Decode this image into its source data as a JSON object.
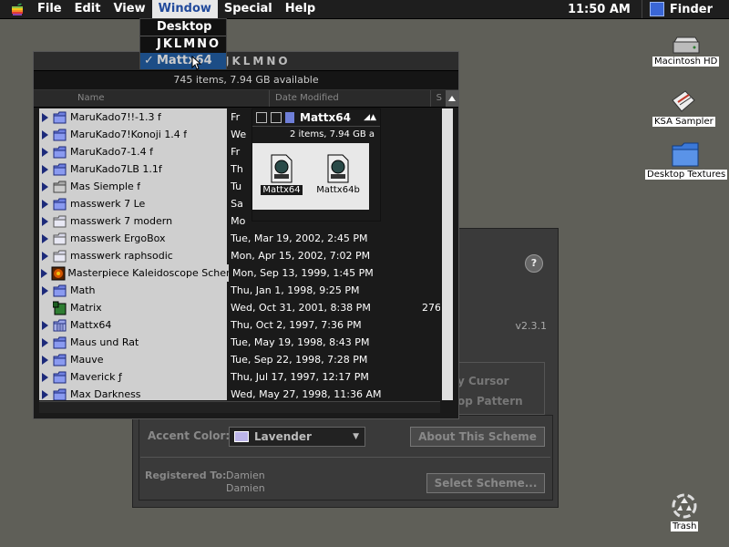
{
  "menubar": {
    "items": [
      "File",
      "Edit",
      "View",
      "Window",
      "Special",
      "Help"
    ],
    "active": "Window",
    "clock": "11:50 AM",
    "app": "Finder"
  },
  "window_menu": {
    "items": [
      {
        "label": "Desktop",
        "checked": false
      },
      {
        "label": "JKLMNO",
        "checked": false
      },
      {
        "label": "Mattx64",
        "checked": true
      }
    ]
  },
  "finder_window": {
    "title": "JKLMNO",
    "info": "745 items, 7.94 GB available",
    "headers": {
      "name": "Name",
      "date": "Date Modified",
      "size": "S"
    },
    "rows": [
      {
        "name": "MaruKado7!!-1.3 f",
        "date": "Fr",
        "size": "",
        "icon": "folder-blue",
        "expand": true
      },
      {
        "name": "MaruKado7!Konoji 1.4 f",
        "date": "We",
        "size": "",
        "icon": "folder-blue",
        "expand": true
      },
      {
        "name": "MaruKado7-1.4 f",
        "date": "Fr",
        "size": "",
        "icon": "folder-blue",
        "expand": true
      },
      {
        "name": "MaruKado7LB 1.1f",
        "date": "Th",
        "size": "",
        "icon": "folder-blue",
        "expand": true
      },
      {
        "name": "Mas Siemple f",
        "date": "Tu",
        "size": "",
        "icon": "folder-gray",
        "expand": true
      },
      {
        "name": "masswerk 7 Le",
        "date": "Sa",
        "size": "",
        "icon": "folder-blue",
        "expand": true
      },
      {
        "name": "masswerk 7 modern",
        "date": "Mo",
        "size": "",
        "icon": "folder-plain",
        "expand": true
      },
      {
        "name": "masswerk ErgoBox",
        "date": "Tue, Mar 19, 2002, 2:45 PM",
        "size": "",
        "icon": "folder-plain",
        "expand": true
      },
      {
        "name": "masswerk raphsodic",
        "date": "Mon, Apr 15, 2002, 7:02 PM",
        "size": "",
        "icon": "folder-plain",
        "expand": true
      },
      {
        "name": "Masterpiece Kaleidoscope Scheme",
        "date": "Mon, Sep 13, 1999, 1:45 PM",
        "size": "",
        "icon": "kaleidoscope",
        "expand": true
      },
      {
        "name": "Math",
        "date": "Thu, Jan 1, 1998, 9:25 PM",
        "size": "",
        "icon": "folder-blue",
        "expand": true
      },
      {
        "name": "Matrix",
        "date": "Wed, Oct 31, 2001, 8:38 PM",
        "size": "276",
        "icon": "matrix-app",
        "expand": false
      },
      {
        "name": "Mattx64",
        "date": "Thu, Oct 2, 1997, 7:36 PM",
        "size": "",
        "icon": "folder-grid",
        "expand": true
      },
      {
        "name": "Maus und Rat",
        "date": "Tue, May 19, 1998, 8:43 PM",
        "size": "",
        "icon": "folder-blue",
        "expand": true
      },
      {
        "name": "Mauve",
        "date": "Tue, Sep 22, 1998, 7:28 PM",
        "size": "",
        "icon": "folder-blue",
        "expand": true
      },
      {
        "name": "Maverick ƒ",
        "date": "Thu, Jul 17, 1997, 12:17 PM",
        "size": "",
        "icon": "folder-blue",
        "expand": true
      },
      {
        "name": "Max Darkness",
        "date": "Wed, May 27, 1998, 11:36 AM",
        "size": "",
        "icon": "folder-blue",
        "expand": true
      }
    ]
  },
  "mattx_window": {
    "title": "Mattx64",
    "info": "2 items, 7.94 GB a",
    "icons": [
      {
        "label": "Mattx64",
        "selected": true
      },
      {
        "label": "Mattx64b",
        "selected": false
      }
    ]
  },
  "control_panel": {
    "version": "v2.3.1",
    "partial_options": [
      "y Cursor",
      "op Pattern"
    ],
    "accent_label": "Accent Color:",
    "accent_value": "Lavender",
    "about_button": "About This Scheme",
    "registered_label": "Registered To:",
    "registered_names": [
      "Damien",
      "Damien"
    ],
    "select_button": "Select Scheme...",
    "help_glyph": "?"
  },
  "desktop_icons": [
    {
      "label": "Macintosh HD",
      "icon": "hard-drive-icon"
    },
    {
      "label": "KSA Sampler",
      "icon": "document-icon"
    },
    {
      "label": "Desktop Textures",
      "icon": "folder-icon"
    },
    {
      "label": "Trash",
      "icon": "trash-icon"
    }
  ]
}
